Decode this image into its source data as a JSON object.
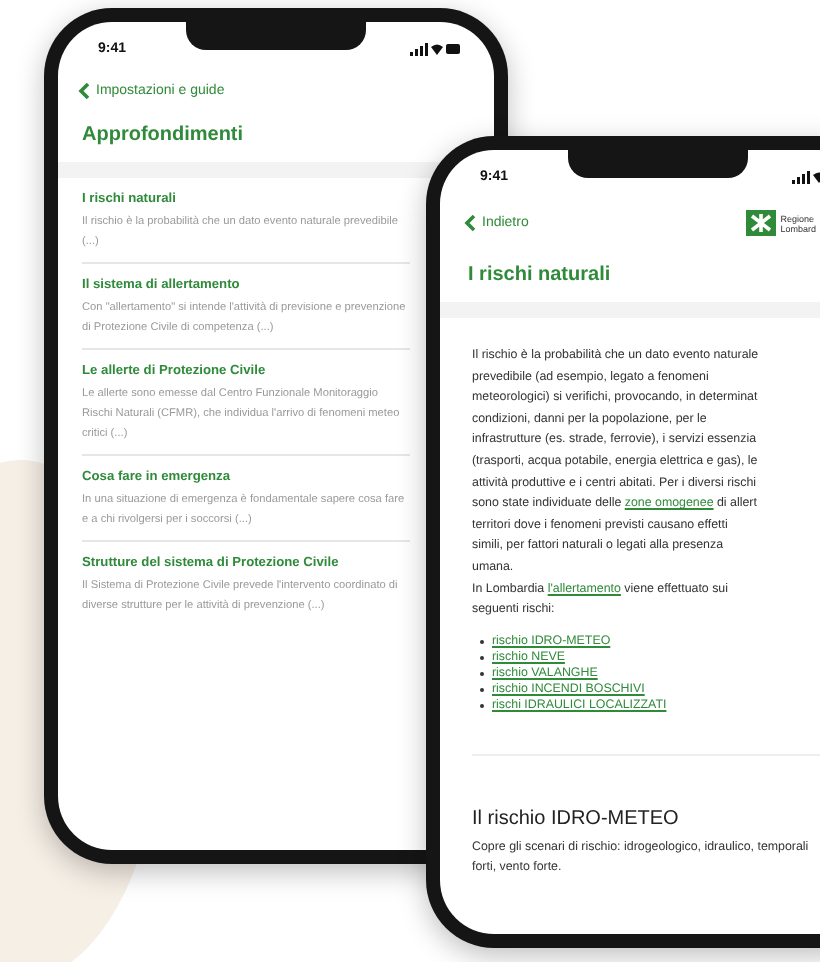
{
  "left_phone": {
    "time": "9:41",
    "back_label": "Impostazioni e guide",
    "title": "Approfondimenti",
    "items": [
      {
        "title": "I rischi naturali",
        "description": "Il rischio è la probabilità che un dato evento naturale prevedibile (...)"
      },
      {
        "title": "Il sistema di allertamento",
        "description": "Con \"allertamento\" si intende l'attività di previsione e prevenzione di Protezione Civile di competenza (...)"
      },
      {
        "title": "Le allerte di Protezione Civile",
        "description": "Le allerte sono emesse dal Centro Funzionale Monitoraggio Rischi Naturali (CFMR), che individua l'arrivo di fenomeni meteo critici (...)"
      },
      {
        "title": "Cosa fare in emergenza",
        "description": "In una situazione di emergenza è fondamentale sapere cosa fare e a chi rivolgersi per i soccorsi (...)"
      },
      {
        "title": "Strutture del sistema di Protezione Civile",
        "description": "Il Sistema di Protezione Civile prevede l'intervento coordinato di diverse strutture per le attività di prevenzione (...)"
      }
    ]
  },
  "right_phone": {
    "time": "9:41",
    "back_label": "Indietro",
    "logo_text": [
      "Regione",
      "Lombard"
    ],
    "title": "I rischi naturali",
    "paragraph_lines": [
      [
        {
          "text": "Il rischio è la probabilità che un dato evento naturale",
          "link": false
        }
      ],
      [
        {
          "text": "prevedibile (ad esempio, legato a fenomeni",
          "link": false
        }
      ],
      [
        {
          "text": "meteorologici) si verifichi, provocando, in determinat",
          "link": false
        }
      ],
      [
        {
          "text": "condizioni, danni per la popolazione, per le",
          "link": false
        }
      ],
      [
        {
          "text": "infrastrutture (es. strade, ferrovie), i servizi essenzia",
          "link": false
        }
      ],
      [
        {
          "text": "(trasporti, acqua potabile, energia elettrica e gas), le",
          "link": false
        }
      ],
      [
        {
          "text": "attività produttive e i centri abitati. Per i diversi rischi",
          "link": false
        }
      ],
      [
        {
          "text": "sono state individuate delle ",
          "link": false
        },
        {
          "text": "zone omogenee",
          "link": true
        },
        {
          "text": " di allert",
          "link": false
        }
      ],
      [
        {
          "text": "territori dove i fenomeni previsti causano effetti",
          "link": false
        }
      ],
      [
        {
          "text": "simili, per fattori naturali o legati alla presenza",
          "link": false
        }
      ],
      [
        {
          "text": "umana.",
          "link": false
        }
      ],
      [
        {
          "text": "In Lombardia ",
          "link": false
        },
        {
          "text": "l'allertamento",
          "link": true
        },
        {
          "text": " viene effettuato sui",
          "link": false
        }
      ],
      [
        {
          "text": "seguenti rischi:",
          "link": false
        }
      ]
    ],
    "risk_links": [
      "rischio IDRO-METEO",
      "rischio NEVE",
      "rischio VALANGHE",
      "rischio INCENDI BOSCHIVI",
      "rischi IDRAULICI LOCALIZZATI"
    ],
    "section_title": "Il rischio IDRO-METEO",
    "section_text": "Copre gli scenari di rischio: idrogeologico, idraulico, temporali forti, vento forte."
  }
}
